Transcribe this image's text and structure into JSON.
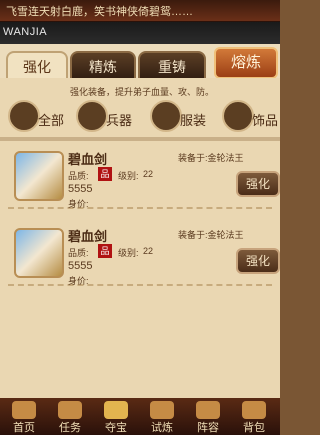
{
  "top": {
    "marquee": "飞雪连天射白鹿，笑书神侠倚碧鸳……"
  },
  "titlebar": {
    "text": "WANJIA"
  },
  "tabs": [
    {
      "label": "强化",
      "active": true
    },
    {
      "label": "精炼",
      "active": false
    },
    {
      "label": "重铸",
      "active": false
    }
  ],
  "melt_button": "熔炼",
  "panel": {
    "desc": "强化装备，提升弟子血量、攻、防。"
  },
  "categories": [
    {
      "label": "全部",
      "icon": "bag-icon",
      "selected": true
    },
    {
      "label": "兵器",
      "icon": "sword-icon",
      "selected": false
    },
    {
      "label": "服装",
      "icon": "armor-icon",
      "selected": false
    },
    {
      "label": "饰品",
      "icon": "ring-icon",
      "selected": false
    }
  ],
  "items": [
    {
      "name": "碧血剑",
      "quality_label": "品质:",
      "level_label": "级别:",
      "level": "22",
      "power": "5555",
      "price_label": "身价:",
      "equip_label": "装备于:",
      "equip_target": "金轮法王",
      "action": "强化"
    },
    {
      "name": "碧血剑",
      "quality_label": "品质:",
      "level_label": "级别:",
      "level": "22",
      "power": "5555",
      "price_label": "身价:",
      "equip_label": "装备于:",
      "equip_target": "金轮法王",
      "action": "强化"
    }
  ],
  "bottom_nav": [
    {
      "label": "首页",
      "icon": "home-icon"
    },
    {
      "label": "任务",
      "icon": "scroll-icon"
    },
    {
      "label": "夺宝",
      "icon": "treasure-icon",
      "selected": true
    },
    {
      "label": "试炼",
      "icon": "trial-icon"
    },
    {
      "label": "阵容",
      "icon": "team-icon"
    },
    {
      "label": "背包",
      "icon": "bag-icon"
    }
  ]
}
